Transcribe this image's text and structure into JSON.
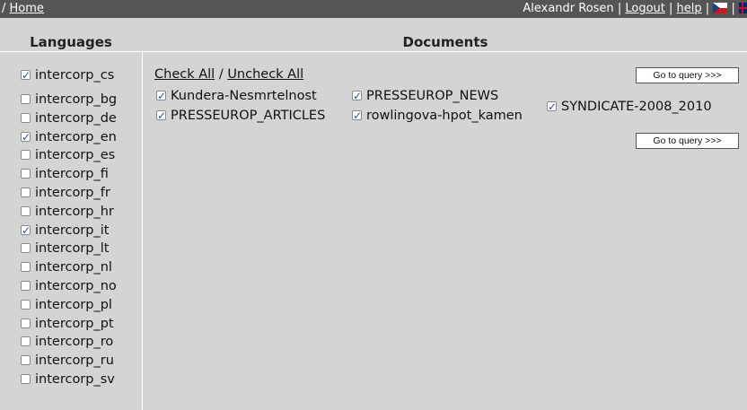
{
  "topbar": {
    "crumb_sep": "/",
    "home": "Home",
    "user": "Alexandr Rosen",
    "sep": "|",
    "logout": "Logout",
    "help": "help"
  },
  "headers": {
    "languages": "Languages",
    "documents": "Documents"
  },
  "languages": {
    "primary": {
      "label": "intercorp_cs",
      "checked": true
    },
    "items": [
      {
        "label": "intercorp_bg",
        "checked": false
      },
      {
        "label": "intercorp_de",
        "checked": false
      },
      {
        "label": "intercorp_en",
        "checked": true
      },
      {
        "label": "intercorp_es",
        "checked": false
      },
      {
        "label": "intercorp_fi",
        "checked": false
      },
      {
        "label": "intercorp_fr",
        "checked": false
      },
      {
        "label": "intercorp_hr",
        "checked": false
      },
      {
        "label": "intercorp_it",
        "checked": true
      },
      {
        "label": "intercorp_lt",
        "checked": false
      },
      {
        "label": "intercorp_nl",
        "checked": false
      },
      {
        "label": "intercorp_no",
        "checked": false
      },
      {
        "label": "intercorp_pl",
        "checked": false
      },
      {
        "label": "intercorp_pt",
        "checked": false
      },
      {
        "label": "intercorp_ro",
        "checked": false
      },
      {
        "label": "intercorp_ru",
        "checked": false
      },
      {
        "label": "intercorp_sv",
        "checked": false
      }
    ]
  },
  "documents": {
    "check_all": "Check All",
    "slash": "/",
    "uncheck_all": "Uncheck All",
    "go_button": "Go to query >>>",
    "items": [
      {
        "label": "Kundera-Nesmrtelnost",
        "checked": true
      },
      {
        "label": "PRESSEUROP_NEWS",
        "checked": true
      },
      {
        "label": "SYNDICATE-2008_2010",
        "checked": true
      },
      {
        "label": "PRESSEUROP_ARTICLES",
        "checked": true
      },
      {
        "label": "rowlingova-hpot_kamen",
        "checked": true
      }
    ]
  }
}
